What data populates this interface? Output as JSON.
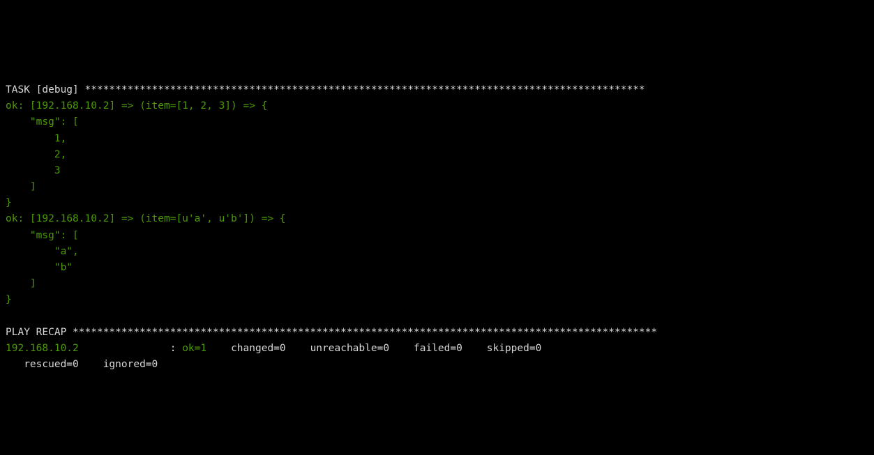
{
  "task": {
    "label_prefix": "TASK",
    "name": "debug",
    "stars": "********************************************************************************************"
  },
  "results": [
    {
      "status": "ok",
      "host": "192.168.10.2",
      "item": "[1, 2, 3]",
      "msg_key": "\"msg\"",
      "msg_values": [
        "1,",
        "2,",
        "3"
      ]
    },
    {
      "status": "ok",
      "host": "192.168.10.2",
      "item": "[u'a', u'b']",
      "msg_key": "\"msg\"",
      "msg_values": [
        "\"a\",",
        "\"b\""
      ]
    }
  ],
  "recap": {
    "label": "PLAY RECAP",
    "stars": "************************************************************************************************",
    "host": "192.168.10.2",
    "colon": ": ",
    "ok_label": "ok=",
    "ok_value": "1",
    "changed_label": "changed=",
    "changed_value": "0",
    "unreachable_label": "unreachable=",
    "unreachable_value": "0",
    "failed_label": "failed=",
    "failed_value": "0",
    "skipped_label": "skipped=",
    "skipped_value": "0",
    "rescued_label": "rescued=",
    "rescued_value": "0",
    "ignored_label": "ignored=",
    "ignored_value": "0"
  }
}
